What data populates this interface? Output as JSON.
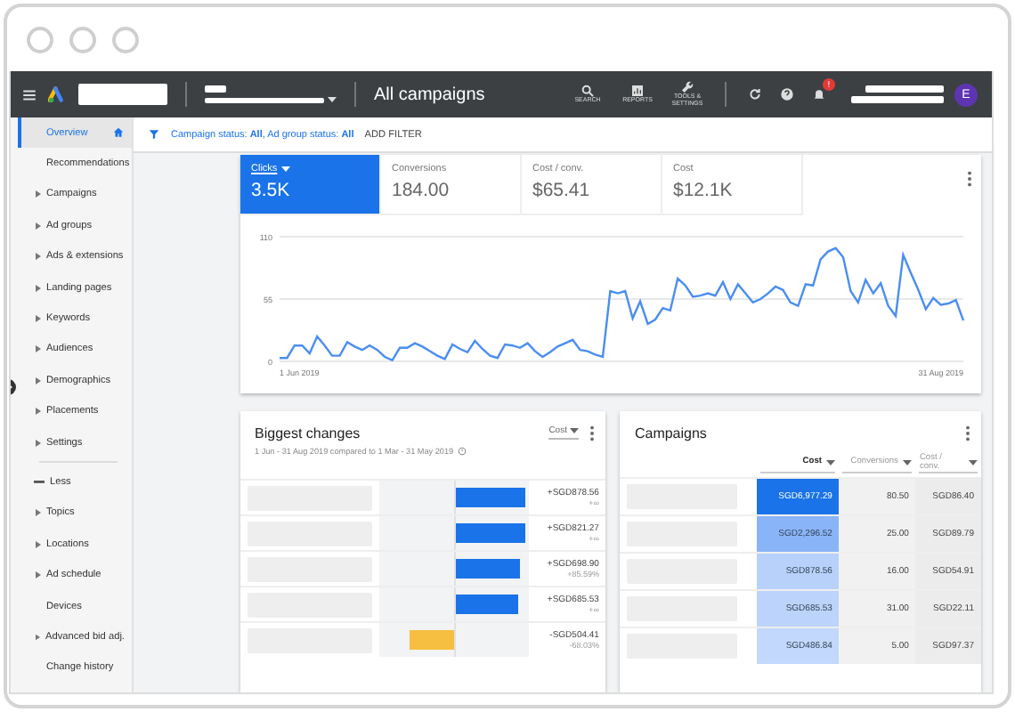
{
  "header": {
    "title": "All campaigns",
    "tools": [
      {
        "kind": "search",
        "label": "SEARCH"
      },
      {
        "kind": "reports",
        "label": "REPORTS"
      },
      {
        "kind": "tools",
        "label": "TOOLS & SETTINGS"
      }
    ],
    "notification_badge": "!",
    "avatar": "E"
  },
  "filter": {
    "text": "Campaign status: **All**, Ad group status: **All**",
    "button": "ADD FILTER"
  },
  "sidebar": {
    "items": [
      {
        "label": "Overview",
        "selected": true,
        "kind": "home"
      },
      {
        "label": "Recommendations",
        "selected": false,
        "kind": "plain"
      },
      {
        "label": "Campaigns",
        "selected": false,
        "kind": "expand"
      },
      {
        "label": "Ad groups",
        "selected": false,
        "kind": "expand"
      },
      {
        "label": "Ads & extensions",
        "selected": false,
        "kind": "expand"
      },
      {
        "label": "Landing pages",
        "selected": false,
        "kind": "expand"
      },
      {
        "label": "Keywords",
        "selected": false,
        "kind": "expand"
      },
      {
        "label": "Audiences",
        "selected": false,
        "kind": "expand"
      },
      {
        "label": "Demographics",
        "selected": false,
        "kind": "expand"
      },
      {
        "label": "Placements",
        "selected": false,
        "kind": "expand"
      },
      {
        "label": "Settings",
        "selected": false,
        "kind": "expand"
      },
      {
        "label": "Less",
        "selected": false,
        "kind": "less"
      },
      {
        "label": "Topics",
        "selected": false,
        "kind": "expand"
      },
      {
        "label": "Locations",
        "selected": false,
        "kind": "expand"
      },
      {
        "label": "Ad schedule",
        "selected": false,
        "kind": "expand"
      },
      {
        "label": "Devices",
        "selected": false,
        "kind": "plain"
      },
      {
        "label": "Advanced bid adj.",
        "selected": false,
        "kind": "expand"
      },
      {
        "label": "Change history",
        "selected": false,
        "kind": "plain"
      }
    ]
  },
  "metrics": [
    {
      "label": "Clicks",
      "value": "3.5K",
      "selected": true
    },
    {
      "label": "Conversions",
      "value": "184.00",
      "selected": false
    },
    {
      "label": "Cost / conv.",
      "value": "$65.41",
      "selected": false
    },
    {
      "label": "Cost",
      "value": "$12.1K",
      "selected": false
    }
  ],
  "chart_start": "1 Jun 2019",
  "chart_end": "31 Aug 2019",
  "chart_data": {
    "type": "line",
    "ylim": [
      0,
      110
    ],
    "yticks": [
      0,
      55,
      110
    ],
    "series": [
      {
        "color": "#4a8ef0",
        "values": [
          3,
          3,
          14,
          14,
          7,
          22,
          14,
          5,
          5,
          17,
          13,
          10,
          14,
          10,
          4,
          1,
          12,
          12,
          16,
          13,
          9,
          5,
          2,
          15,
          11,
          8,
          18,
          11,
          5,
          3,
          15,
          14,
          12,
          16,
          9,
          4,
          8,
          13,
          16,
          19,
          10,
          9,
          6,
          4,
          62,
          60,
          62,
          38,
          53,
          33,
          37,
          47,
          45,
          73,
          67,
          57,
          58,
          60,
          58,
          70,
          55,
          68,
          60,
          52,
          55,
          60,
          66,
          63,
          52,
          49,
          68,
          67,
          90,
          97,
          100,
          92,
          62,
          52,
          72,
          60,
          69,
          49,
          40,
          94,
          78,
          63,
          46,
          56,
          50,
          51,
          54,
          36
        ]
      }
    ]
  },
  "changes": {
    "title": "Biggest changes",
    "subtitle": "1 Jun - 31 Aug 2019 compared to 1 Mar - 31 May 2019",
    "metric": "Cost",
    "rows": [
      {
        "kind": "up",
        "level": 0.95,
        "amount": "+SGD878.56",
        "percent": "+∞"
      },
      {
        "kind": "up",
        "level": 0.95,
        "amount": "+SGD821.27",
        "percent": "+∞"
      },
      {
        "kind": "up",
        "level": 0.88,
        "amount": "+SGD698.90",
        "percent": "+85.59%"
      },
      {
        "kind": "up",
        "level": 0.86,
        "amount": "+SGD685.53",
        "percent": "+∞"
      },
      {
        "kind": "down",
        "level": 0.6,
        "amount": "-SGD504.41",
        "percent": "-68.03%"
      }
    ]
  },
  "campaigns": {
    "title": "Campaigns",
    "columns": [
      "Cost",
      "Conversions",
      "Cost / conv."
    ],
    "rows": [
      {
        "cost": "SGD6,977.29",
        "conversions": "80.50",
        "cost_per_conv": "SGD86.40",
        "color": "#1a73e8"
      },
      {
        "cost": "SGD2,296.52",
        "conversions": "25.00",
        "cost_per_conv": "SGD89.79",
        "color": "#8ab4f8"
      },
      {
        "cost": "SGD878.56",
        "conversions": "16.00",
        "cost_per_conv": "SGD54.91",
        "color": "#b7d1fb"
      },
      {
        "cost": "SGD685.53",
        "conversions": "31.00",
        "cost_per_conv": "SGD22.11",
        "color": "#bcd4fb"
      },
      {
        "cost": "SGD486.84",
        "conversions": "5.00",
        "cost_per_conv": "SGD97.37",
        "color": "#c2d8fc"
      }
    ]
  }
}
